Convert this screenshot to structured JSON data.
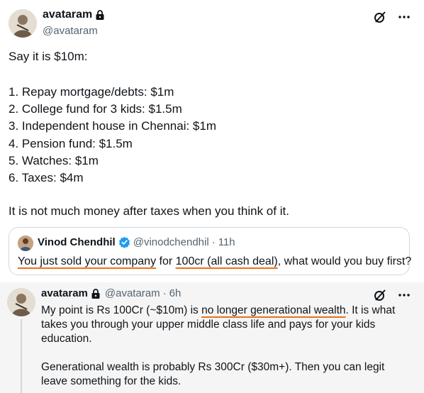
{
  "main_tweet": {
    "display_name": "avataram",
    "handle": "@avataram",
    "intro": "Say it is $10m:",
    "list": [
      "1. Repay mortgage/debts: $1m",
      "2. College fund for 3 kids: $1.5m",
      "3. Independent house in Chennai: $1m",
      "4. Pension fund: $1.5m",
      "5. Watches: $1m",
      "6. Taxes: $4m"
    ],
    "outro": "It is not much money after taxes when you think of it.",
    "icons": {
      "lock": "lock-icon",
      "grok": "grok-icon",
      "more": "more-icon"
    }
  },
  "quote": {
    "display_name": "Vinod Chendhil",
    "handle": "@vinodchendhil",
    "separator": "·",
    "time": "11h",
    "text_highlighted_1": "You just sold your company",
    "text_plain_1": " for ",
    "text_highlighted_2": "100cr (all cash deal)",
    "text_plain_2": ", what would you buy first?",
    "verified_color": "#1d9bf0",
    "highlight_color": "#e8731c"
  },
  "reply": {
    "display_name": "avataram",
    "handle": "@avataram",
    "separator": "·",
    "time": "6h",
    "para1_a": "My point is Rs 100Cr (~$10m) is ",
    "para1_highlight": "no longer generational wealth",
    "para1_b": ". It is what takes you through your upper middle class life and pays for your kids education.",
    "para2": "Generational wealth is probably Rs 300Cr ($30m+). Then you can legit leave something for the kids."
  }
}
